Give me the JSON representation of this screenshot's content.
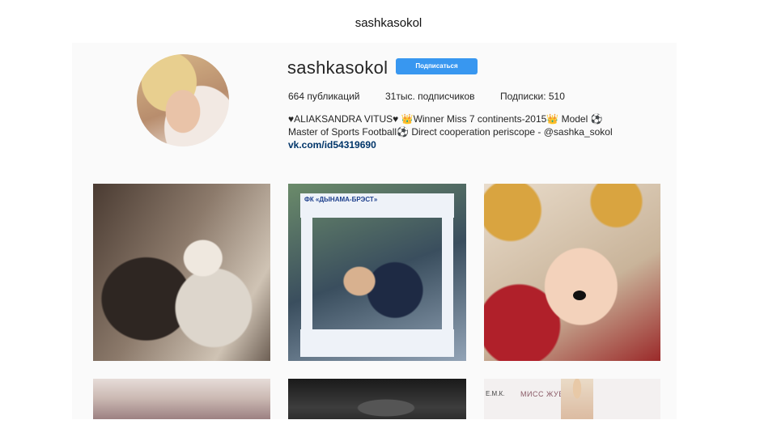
{
  "slide": {
    "title": "sashkasokol"
  },
  "profile": {
    "username": "sashkasokol",
    "follow_label": "Подписаться",
    "stats": {
      "posts": "664 публикаций",
      "followers": "31тыс. подписчиков",
      "following": "Подписки: 510"
    },
    "bio": {
      "line1": "♥ALIAKSANDRA VITUS♥ 👑Winner Miss 7 continents-2015👑 Model ⚽",
      "line2": "Master of Sports Football⚽ Direct cooperation periscope - @sashka_sokol",
      "link": "vk.com/id54319690"
    }
  },
  "posts": {
    "photo2_caption": "ФК «ДЫНАМА-БРЭСТ»",
    "photo6_caption": "МИСС ЖУЕ",
    "photo6_side": "Е.М.К."
  }
}
